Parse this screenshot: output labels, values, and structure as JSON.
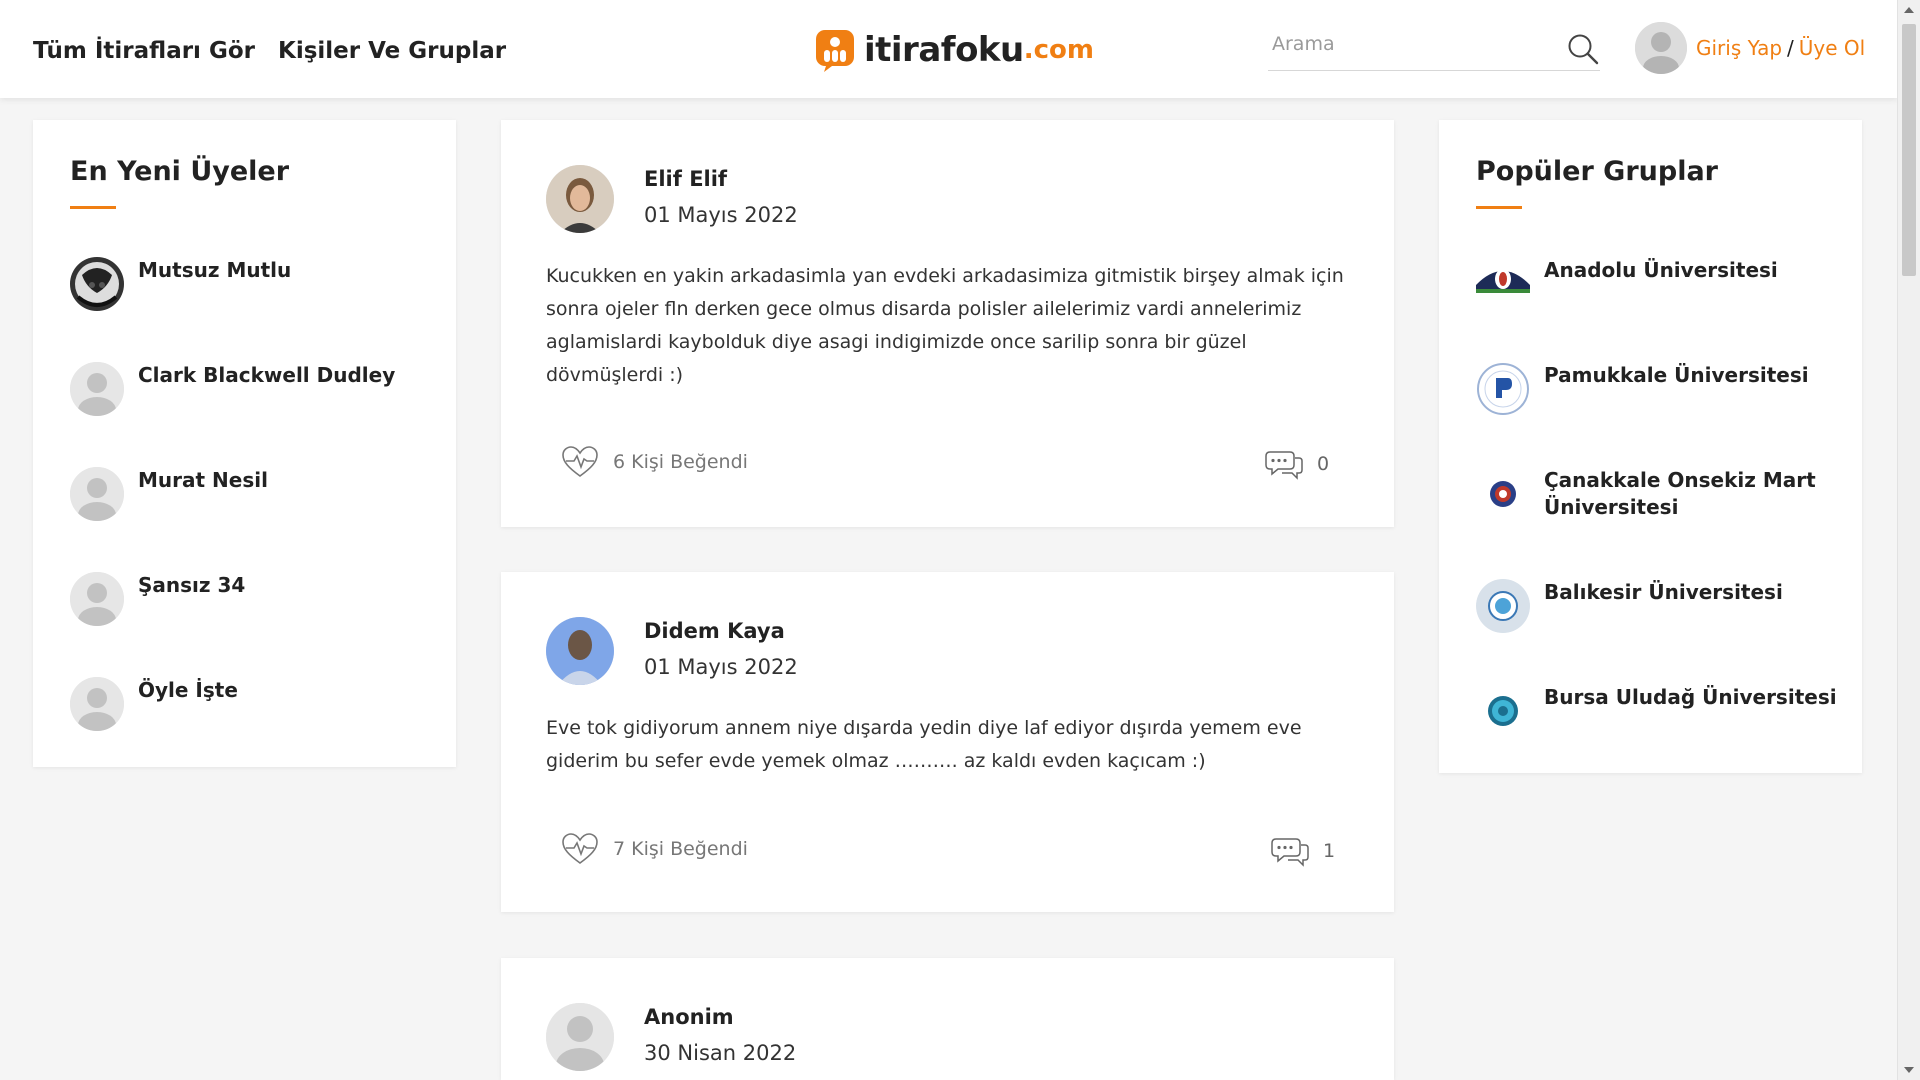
{
  "nav": {
    "all_confessions": "Tüm İtirafları Gör",
    "people_groups": "Kişiler Ve Gruplar"
  },
  "logo": {
    "name": "itirafoku",
    "domain": ".com"
  },
  "search": {
    "placeholder": "Arama"
  },
  "auth": {
    "login": "Giriş Yap",
    "separator": "/",
    "register": "Üye Ol"
  },
  "newest_members": {
    "title": "En Yeni Üyeler",
    "items": [
      {
        "name": "Mutsuz Mutlu",
        "avatar": "photo-avatar"
      },
      {
        "name": "Clark Blackwell Dudley",
        "avatar": "default-avatar"
      },
      {
        "name": "Murat Nesil",
        "avatar": "default-avatar"
      },
      {
        "name": "Şansız 34",
        "avatar": "default-avatar"
      },
      {
        "name": "Öyle İşte",
        "avatar": "default-avatar"
      }
    ]
  },
  "popular_groups": {
    "title": "Popüler Gruplar",
    "items": [
      {
        "name": "Anadolu Üniversitesi",
        "logo": "university-logo"
      },
      {
        "name": "Pamukkale Üniversitesi",
        "logo": "university-logo"
      },
      {
        "name": "Çanakkale Onsekiz Mart Üniversitesi",
        "logo": "university-logo"
      },
      {
        "name": "Balıkesir Üniversitesi",
        "logo": "university-logo"
      },
      {
        "name": "Bursa Uludağ Üniversitesi",
        "logo": "university-logo"
      }
    ]
  },
  "posts": [
    {
      "author": "Elif Elif",
      "date": "01 Mayıs 2022",
      "text": "Kucukken en yakin arkadasimla yan evdeki arkadasimiza gitmistik birşey almak için sonra ojeler fln derken gece olmus disarda polisler ailelerimiz vardi annelerimiz aglamislardi kaybolduk diye asagi indigimizde once sarilip sonra bir güzel dövmüşlerdi :)",
      "likes": "6 Kişi Beğendi",
      "comments": "0"
    },
    {
      "author": "Didem Kaya",
      "date": "01 Mayıs 2022",
      "text": "Eve tok gidiyorum annem niye dışarda yedin diye laf ediyor dışırda yemem eve giderim bu sefer evde yemek olmaz ………. az kaldı evden kaçıcam :)",
      "likes": "7 Kişi Beğendi",
      "comments": "1"
    },
    {
      "author": "Anonim",
      "date": "30 Nisan 2022",
      "text": "",
      "likes": "",
      "comments": ""
    }
  ],
  "colors": {
    "accent": "#f07f13",
    "background": "#f5f5f5",
    "card": "#ffffff"
  }
}
